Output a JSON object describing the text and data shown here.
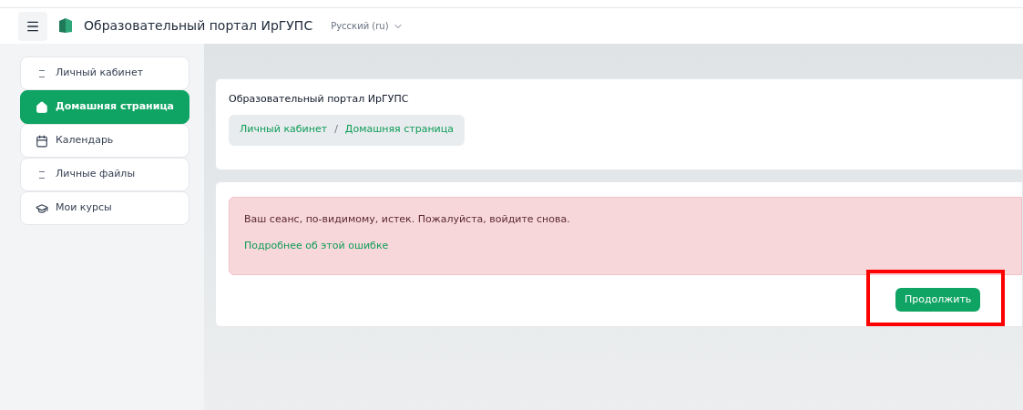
{
  "navbar": {
    "site_name": "Образовательный портал ИрГУПС",
    "language": "Русский (ru)"
  },
  "sidebar": {
    "items": [
      {
        "label": "Личный кабинет",
        "selected": false
      },
      {
        "label": "Домашняя страница",
        "selected": true
      },
      {
        "label": "Календарь",
        "selected": false
      },
      {
        "label": "Личные файлы",
        "selected": false
      },
      {
        "label": "Мои курсы",
        "selected": false
      }
    ]
  },
  "header": {
    "title": "Образовательный портал ИрГУПС",
    "breadcrumbs": [
      "Личный кабинет",
      "Домашняя страница"
    ],
    "separator": "/"
  },
  "alert": {
    "message": "Ваш сеанс, по-видимому, истек. Пожалуйста, войдите снова.",
    "link": "Подробнее об этой ошибке"
  },
  "buttons": [
    "Продолжить"
  ]
}
